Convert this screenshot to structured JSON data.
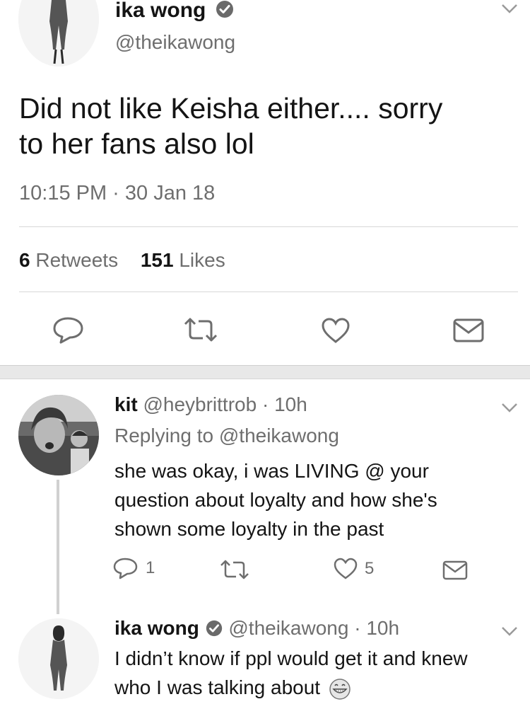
{
  "main_tweet": {
    "author_name": "ika wong",
    "author_handle": "@theikawong",
    "text_line1": "Did not like Keisha either.... sorry",
    "text_line2": "to her fans also lol",
    "timestamp": "10:15 PM · 30 Jan 18",
    "retweets_count": "6",
    "retweets_label": "Retweets",
    "likes_count": "151",
    "likes_label": "Likes"
  },
  "reply_1": {
    "author_name": "kit",
    "author_handle": "@heybrittrob",
    "time": "· 10h",
    "replying_to": "Replying to @theikawong",
    "text_line1": "she was okay, i was LIVING @ your",
    "text_line2": "question about loyalty and how she's",
    "text_line3": "shown some loyalty in the past",
    "reply_count": "1",
    "like_count": "5"
  },
  "reply_2": {
    "author_name": "ika wong",
    "author_handle": "@theikawong",
    "time": "· 10h",
    "text_line1": "I didn’t know if ppl would get it and knew",
    "text_line2": "who I was talking about",
    "emoji": "grinning-face-icon"
  },
  "colors": {
    "text": "#141414",
    "muted": "#6e6e6e",
    "divider": "#d7d7d7",
    "section_gap": "#e8e8e8"
  }
}
